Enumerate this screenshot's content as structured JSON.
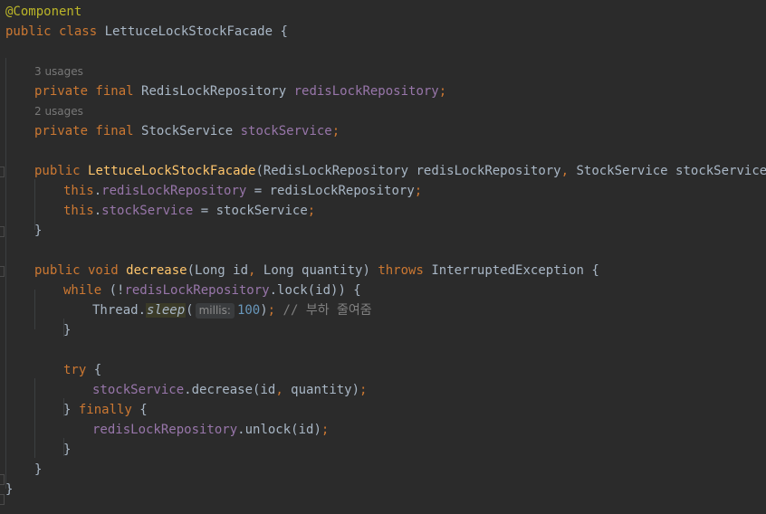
{
  "editor": {
    "theme": {
      "background": "#2b2b2b",
      "keyword": "#cc7832",
      "field": "#9876aa",
      "annotation": "#bbb529",
      "method": "#ffc66d",
      "number": "#6897bb",
      "comment": "#808080",
      "text": "#a9b7c6"
    },
    "lines": [
      {
        "tokens": [
          {
            "c": "ann",
            "t": "@Component"
          }
        ]
      },
      {
        "tokens": [
          {
            "c": "kw",
            "t": "public class "
          },
          {
            "c": "",
            "t": "LettuceLockStockFacade {"
          }
        ]
      },
      {
        "tokens": []
      },
      {
        "tokens": [
          {
            "c": "usage",
            "t": "3 usages"
          }
        ]
      },
      {
        "tokens": [
          {
            "c": "kw",
            "t": "private final "
          },
          {
            "c": "",
            "t": "RedisLockRepository "
          },
          {
            "c": "field",
            "t": "redisLockRepository"
          },
          {
            "c": "kw",
            "t": ";"
          }
        ]
      },
      {
        "tokens": [
          {
            "c": "usage",
            "t": "2 usages"
          }
        ]
      },
      {
        "tokens": [
          {
            "c": "kw",
            "t": "private final "
          },
          {
            "c": "",
            "t": "StockService "
          },
          {
            "c": "field",
            "t": "stockService"
          },
          {
            "c": "kw",
            "t": ";"
          }
        ]
      },
      {
        "tokens": []
      },
      {
        "tokens": [
          {
            "c": "kw",
            "t": "public "
          },
          {
            "c": "fn",
            "t": "LettuceLockStockFacade"
          },
          {
            "c": "",
            "t": "(RedisLockRepository redisLockRepository"
          },
          {
            "c": "kw",
            "t": ", "
          },
          {
            "c": "",
            "t": "StockService stockService) {"
          }
        ]
      },
      {
        "tokens": [
          {
            "c": "kw",
            "t": "this"
          },
          {
            "c": "",
            "t": "."
          },
          {
            "c": "field",
            "t": "redisLockRepository"
          },
          {
            "c": "",
            "t": " = redisLockRepository"
          },
          {
            "c": "kw",
            "t": ";"
          }
        ]
      },
      {
        "tokens": [
          {
            "c": "kw",
            "t": "this"
          },
          {
            "c": "",
            "t": "."
          },
          {
            "c": "field",
            "t": "stockService"
          },
          {
            "c": "",
            "t": " = stockService"
          },
          {
            "c": "kw",
            "t": ";"
          }
        ]
      },
      {
        "tokens": [
          {
            "c": "",
            "t": "}"
          }
        ]
      },
      {
        "tokens": []
      },
      {
        "tokens": [
          {
            "c": "kw",
            "t": "public void "
          },
          {
            "c": "fn",
            "t": "decrease"
          },
          {
            "c": "",
            "t": "(Long id"
          },
          {
            "c": "kw",
            "t": ", "
          },
          {
            "c": "",
            "t": "Long quantity) "
          },
          {
            "c": "kw",
            "t": "throws "
          },
          {
            "c": "",
            "t": "InterruptedException {"
          }
        ]
      },
      {
        "tokens": [
          {
            "c": "kw",
            "t": "while "
          },
          {
            "c": "",
            "t": "(!"
          },
          {
            "c": "field",
            "t": "redisLockRepository"
          },
          {
            "c": "",
            "t": ".lock(id)) {"
          }
        ]
      },
      {
        "tokens": [
          {
            "c": "",
            "t": "Thread."
          },
          {
            "c": "static",
            "t": "sleep"
          },
          {
            "c": "",
            "t": "("
          },
          {
            "c": "hint",
            "t": "millis:"
          },
          {
            "c": "num",
            "t": "100"
          },
          {
            "c": "",
            "t": ")"
          },
          {
            "c": "kw",
            "t": "; "
          },
          {
            "c": "com",
            "t": "// 부하 줄여줌"
          }
        ]
      },
      {
        "tokens": [
          {
            "c": "",
            "t": "}"
          }
        ]
      },
      {
        "tokens": []
      },
      {
        "tokens": [
          {
            "c": "kw",
            "t": "try "
          },
          {
            "c": "",
            "t": "{"
          }
        ]
      },
      {
        "tokens": [
          {
            "c": "field",
            "t": "stockService"
          },
          {
            "c": "",
            "t": ".decrease(id"
          },
          {
            "c": "kw",
            "t": ", "
          },
          {
            "c": "",
            "t": "quantity)"
          },
          {
            "c": "kw",
            "t": ";"
          }
        ]
      },
      {
        "tokens": [
          {
            "c": "",
            "t": "} "
          },
          {
            "c": "kw",
            "t": "finally "
          },
          {
            "c": "",
            "t": "{"
          }
        ]
      },
      {
        "tokens": [
          {
            "c": "field",
            "t": "redisLockRepository"
          },
          {
            "c": "",
            "t": ".unlock(id)"
          },
          {
            "c": "kw",
            "t": ";"
          }
        ]
      },
      {
        "tokens": [
          {
            "c": "",
            "t": "}"
          }
        ]
      },
      {
        "tokens": [
          {
            "c": "",
            "t": "}"
          }
        ]
      },
      {
        "tokens": [
          {
            "c": "",
            "t": "}"
          }
        ]
      }
    ]
  }
}
